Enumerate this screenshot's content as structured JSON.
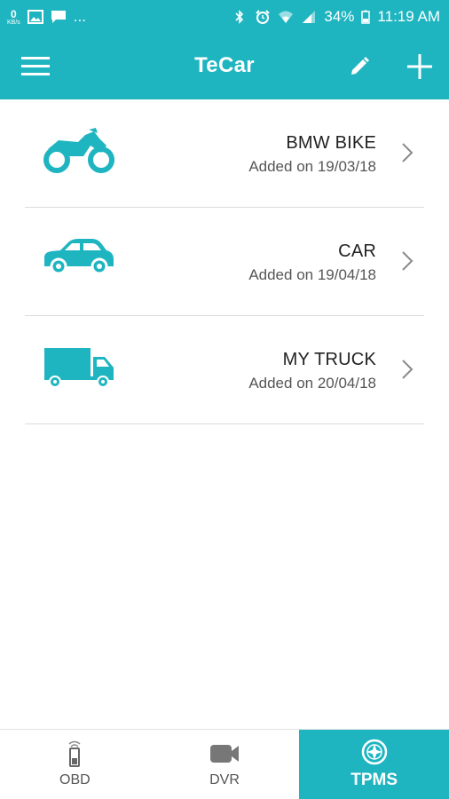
{
  "status_bar": {
    "speed_value": "0",
    "speed_unit": "KB/s",
    "ellipsis": "...",
    "battery": "34%",
    "time": "11:19 AM"
  },
  "app_bar": {
    "title": "TeCar",
    "icons": {
      "menu": "hamburger-menu-icon",
      "edit": "pencil-icon",
      "add": "plus-icon"
    }
  },
  "vehicles": [
    {
      "name": "BMW BIKE",
      "added": "Added on 19/03/18",
      "icon": "motorcycle-icon"
    },
    {
      "name": "CAR",
      "added": "Added on 19/04/18",
      "icon": "car-icon"
    },
    {
      "name": "MY TRUCK",
      "added": "Added on 20/04/18",
      "icon": "truck-icon"
    }
  ],
  "bottom_nav": [
    {
      "label": "OBD",
      "icon": "obd-device-icon",
      "active": false
    },
    {
      "label": "DVR",
      "icon": "video-camera-icon",
      "active": false
    },
    {
      "label": "TPMS",
      "icon": "tire-compass-icon",
      "active": true
    }
  ],
  "colors": {
    "primary": "#1eb5c1",
    "divider": "#dcdcdc",
    "inactive_nav": "#555555"
  }
}
